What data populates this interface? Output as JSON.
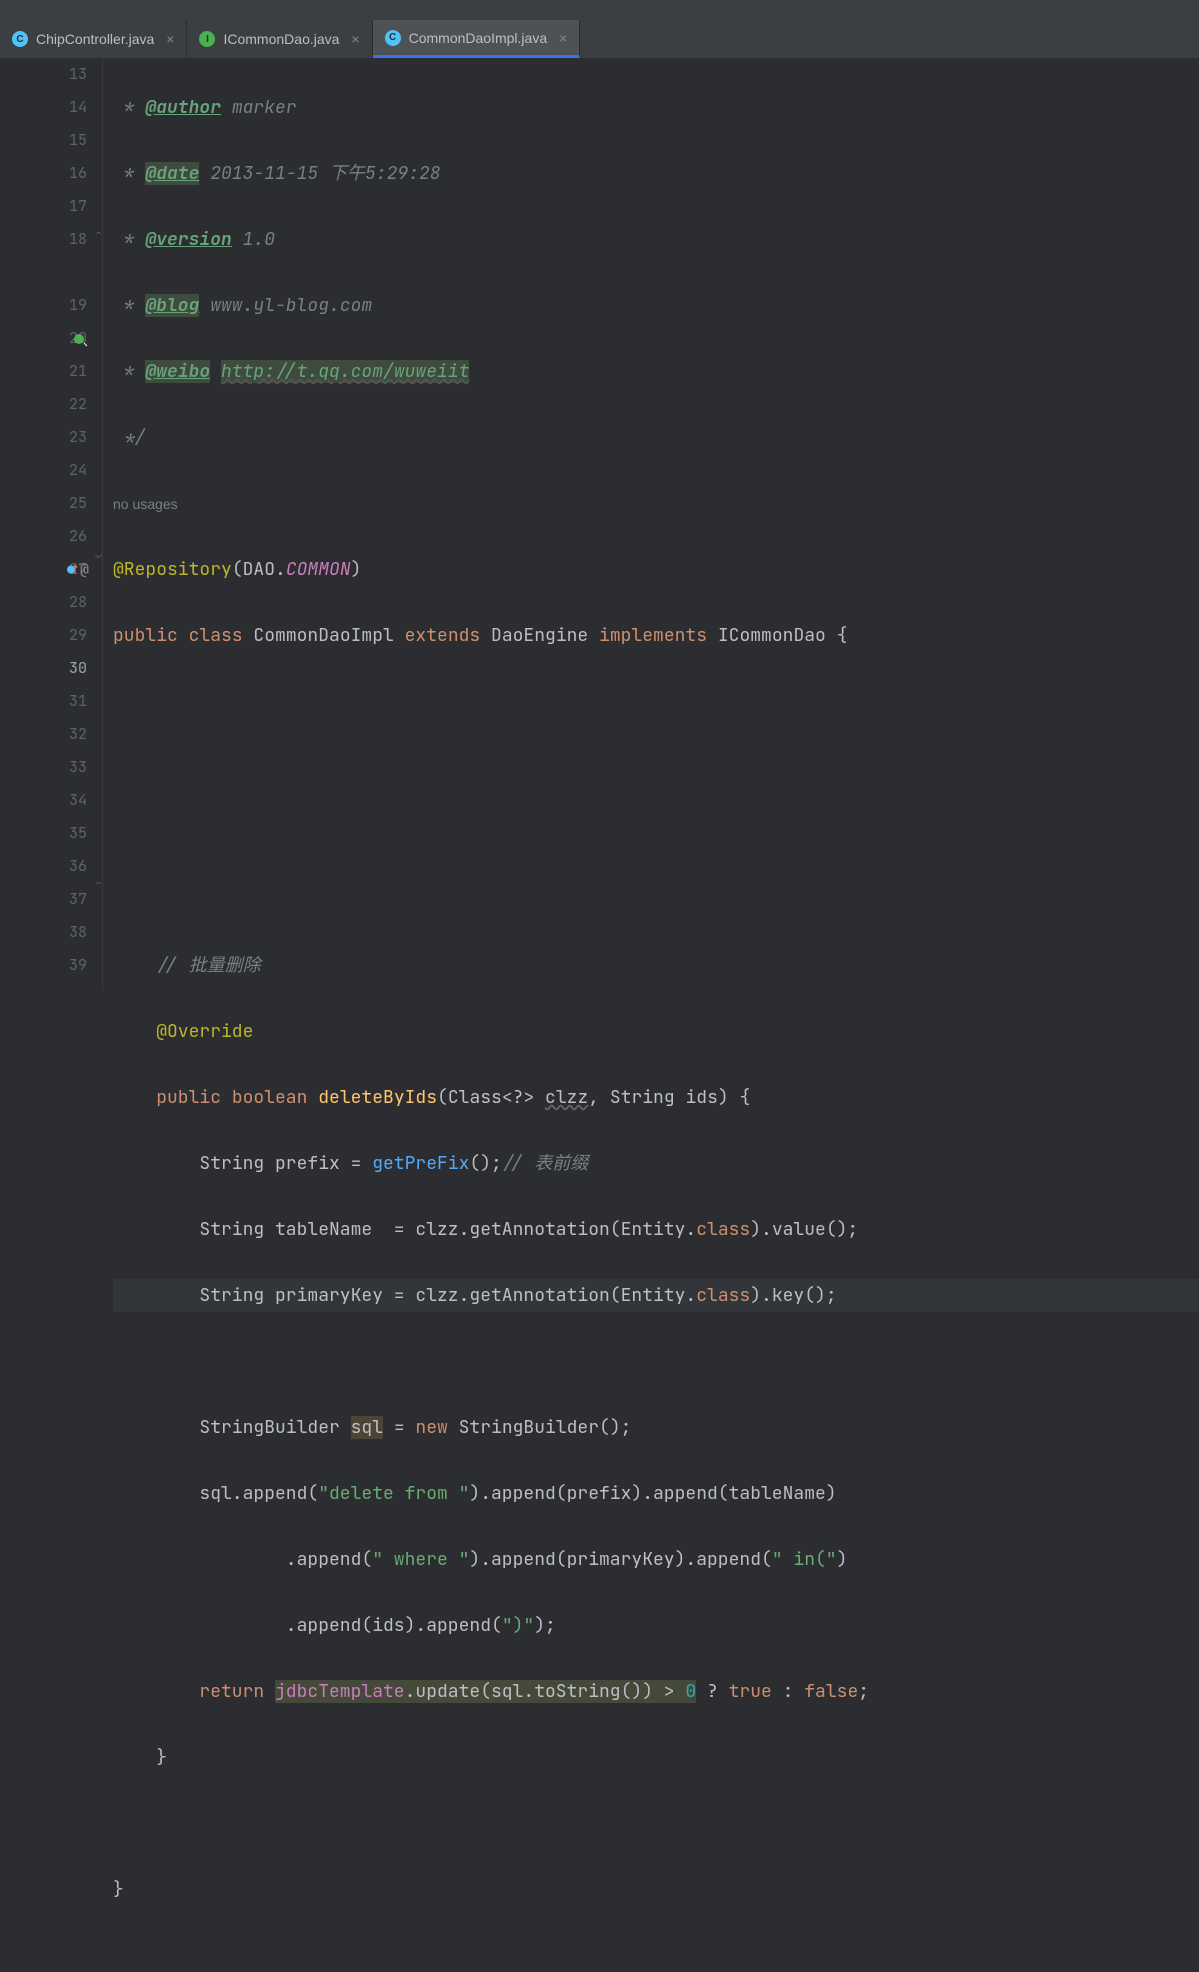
{
  "tabs": [
    {
      "icon": "C",
      "iconClass": "c",
      "label": "ChipController.java",
      "active": false
    },
    {
      "icon": "I",
      "iconClass": "i",
      "label": "ICommonDao.java",
      "active": false
    },
    {
      "icon": "C",
      "iconClass": "c",
      "label": "CommonDaoImpl.java",
      "active": true
    }
  ],
  "lines": {
    "start": 13,
    "end": 39
  },
  "code": {
    "l13": {
      "comment_prefix": " * ",
      "tag": "@author",
      "value": " marker"
    },
    "l14": {
      "comment_prefix": " * ",
      "tag": "@date",
      "value": " 2013-11-15 下午5:29:28"
    },
    "l15": {
      "comment_prefix": " * ",
      "tag": "@version",
      "value": " 1.0"
    },
    "l16": {
      "comment_prefix": " * ",
      "tag": "@blog",
      "value": " www.yl-blog.com"
    },
    "l17": {
      "comment_prefix": " * ",
      "tag": "@weibo",
      "url": "http://t.qq.com/wuweiit"
    },
    "l18": {
      "comment": " */"
    },
    "usages": "no usages",
    "l19": {
      "anno": "@Repository",
      "dao": "DAO.",
      "common": "COMMON"
    },
    "l20": {
      "kw1": "public ",
      "kw2": "class ",
      "name": "CommonDaoImpl ",
      "kw3": "extends ",
      "sup": "DaoEngine ",
      "kw4": "implements ",
      "iface": "ICommonDao "
    },
    "l25": {
      "comment": "    // 批量删除"
    },
    "l26": {
      "anno": "    @Override"
    },
    "l27": {
      "kw1": "    public ",
      "kw2": "boolean ",
      "method": "deleteByIds",
      "p1": "Class<?> ",
      "p1n": "clzz",
      "p2": "String ",
      "p2n": "ids"
    },
    "l28": {
      "type": "        String ",
      "var": "prefix = ",
      "call": "getPreFix",
      "comment": "// 表前缀"
    },
    "l29": {
      "type": "        String ",
      "var": "tableName  = clzz.getAnnotation(",
      "cls": "Entity",
      "kw": "class",
      "suffix": ").value();"
    },
    "l30": {
      "type": "        String ",
      "var": "primaryKey = clzz.getAnnotation(",
      "cls": "Entity",
      "kw": "class",
      "suffix": ").key();"
    },
    "l32": {
      "type": "        StringBuilder ",
      "var": "sql",
      "eq": " = ",
      "kw": "new ",
      "ctor": "StringBuilder();"
    },
    "l33": {
      "prefix": "        sql.append(",
      "s1": "\"delete from \"",
      "mid1": ").append(prefix).append(tableName)"
    },
    "l34": {
      "prefix": "                .append(",
      "s1": "\" where \"",
      "mid1": ").append(primaryKey).append(",
      "s2": "\" in(\"",
      "mid2": ")"
    },
    "l35": {
      "prefix": "                .append(ids).append(",
      "s1": "\")\"",
      "suffix": ");"
    },
    "l36": {
      "kw": "        return ",
      "field": "jdbcTemplate",
      "call": ".update(sql.toString()) > ",
      "num": "0",
      "t": " ? ",
      "kw2": "true",
      "t2": " : ",
      "kw3": "false",
      "t3": ";"
    },
    "l37": "    }",
    "l39": "}"
  }
}
